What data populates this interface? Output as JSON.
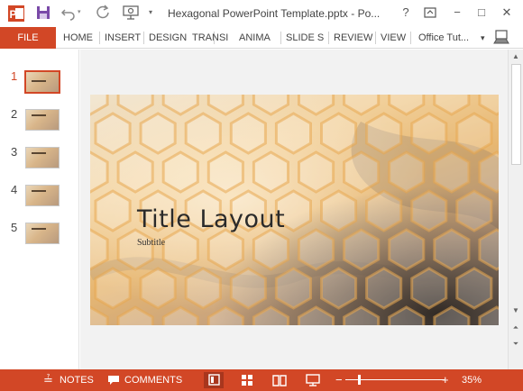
{
  "window": {
    "title": "Hexagonal PowerPoint Template.pptx - Po...",
    "help": "?",
    "minimize": "−",
    "maximize": "□",
    "close": "✕"
  },
  "ribbon": {
    "file_label": "FILE",
    "tabs": [
      "HOME",
      "INSERT",
      "DESIGN",
      "TRANSI",
      "ANIMA",
      "SLIDE S",
      "REVIEW",
      "VIEW"
    ],
    "account": "Office Tut...",
    "account_caret": "▾"
  },
  "thumbnails": {
    "numbers": [
      "1",
      "2",
      "3",
      "4",
      "5"
    ],
    "selected": "1"
  },
  "slide": {
    "title": "Title Layout",
    "subtitle": "Subtitle"
  },
  "statusbar": {
    "notes": "NOTES",
    "comments": "COMMENTS",
    "zoom_minus": "−",
    "zoom_plus": "+",
    "zoom_level": "35%",
    "zoom_fraction": 0.35
  },
  "colors": {
    "accent": "#d24726",
    "ribbon_bg": "#ffffff",
    "canvas_bg": "#f2f2f2"
  },
  "icons": {
    "app": "powerpoint-icon",
    "save": "save-icon",
    "undo": "undo-icon",
    "redo": "redo-icon",
    "present": "presenter-icon",
    "customize": "customize-qat-icon",
    "help": "help-icon",
    "ribbon_display": "ribbon-display-icon"
  }
}
